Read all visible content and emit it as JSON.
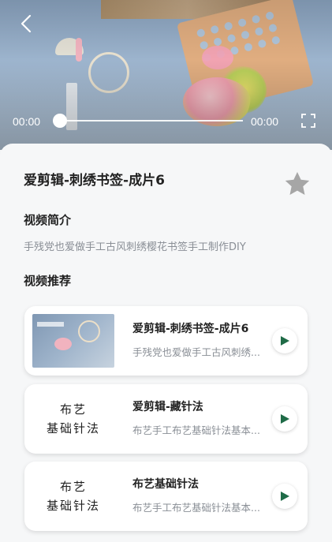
{
  "player": {
    "current_time": "00:00",
    "total_time": "00:00",
    "progress": 0
  },
  "video": {
    "title": "爱剪辑-刺绣书签-成片6",
    "favorited": false
  },
  "intro": {
    "heading": "视频简介",
    "text": "手残党也爱做手工古风刺绣樱花书签手工制作DIY"
  },
  "recommend": {
    "heading": "视频推荐",
    "items": [
      {
        "title": "爱剪辑-刺绣书签-成片6",
        "subtitle": "手残党也爱做手工古风刺绣...",
        "thumb_type": "photo",
        "thumb_text": []
      },
      {
        "title": "爱剪辑-藏针法",
        "subtitle": "布艺手工布艺基础针法基本...",
        "thumb_type": "text",
        "thumb_text": [
          "布艺",
          "基础针法"
        ]
      },
      {
        "title": "布艺基础针法",
        "subtitle": "布艺手工布艺基础针法基本...",
        "thumb_type": "text",
        "thumb_text": [
          "布艺",
          "基础针法"
        ]
      }
    ]
  },
  "icons": {
    "back": "chevron-left-icon",
    "fullscreen": "fullscreen-icon",
    "favorite": "star-icon",
    "play": "play-icon"
  },
  "colors": {
    "accent": "#1f6b47",
    "star_inactive": "#a6a6a6",
    "title_text": "#222222",
    "secondary_text": "#8a8f96"
  }
}
